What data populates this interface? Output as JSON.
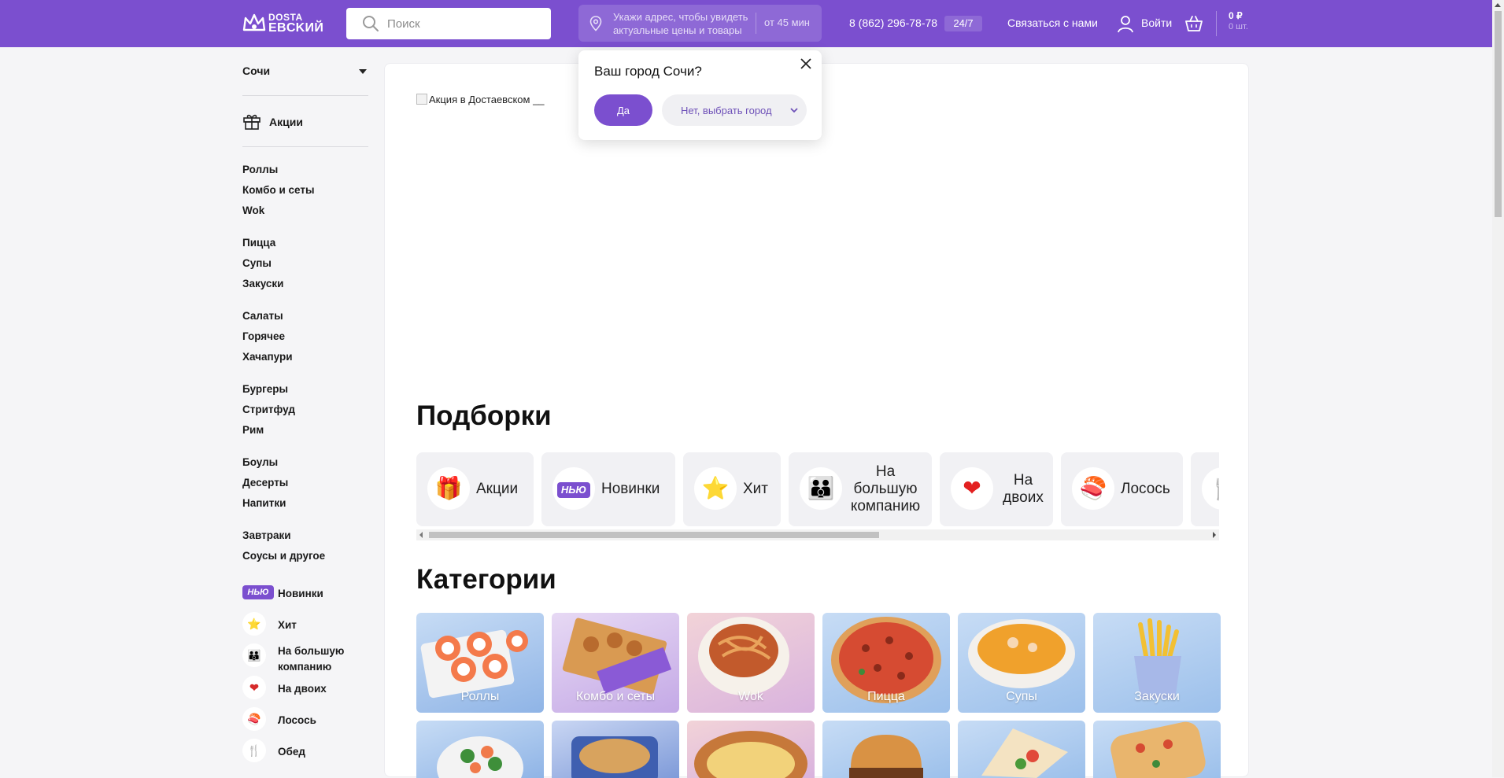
{
  "header": {
    "logo_line1": "DOSTA",
    "logo_line2": "EBCKИЙ",
    "search_placeholder": "Поиск",
    "address_prompt": "Укажи адрес, чтобы увидеть актуальные цены и товары",
    "delivery_time": "от 45 мин",
    "phone": "8 (862) 296-78-78",
    "hours_badge": "24/7",
    "contact_label": "Связаться с нами",
    "login_label": "Войти",
    "cart_sum": "0 ₽",
    "cart_count": "0 шт.",
    "accent_color": "#7b4fcf"
  },
  "sidebar": {
    "city": "Сочи",
    "promo_label": "Акции",
    "groups": [
      [
        "Роллы",
        "Комбо и сеты",
        "Wok"
      ],
      [
        "Пицца",
        "Супы",
        "Закуски"
      ],
      [
        "Салаты",
        "Горячее",
        "Хачапури"
      ],
      [
        "Бургеры",
        "Стритфуд",
        "Рим"
      ],
      [
        "Боулы",
        "Десерты",
        "Напитки"
      ],
      [
        "Завтраки",
        "Соусы и другое"
      ]
    ],
    "new_badge": "НЬЮ",
    "tags": [
      {
        "label": "Новинки",
        "icon": "new-badge"
      },
      {
        "label": "Хит",
        "icon": "star-icon"
      },
      {
        "label": "На большую компанию",
        "icon": "family-icon"
      },
      {
        "label": "На двоих",
        "icon": "heart-icon"
      },
      {
        "label": "Лосось",
        "icon": "salmon-icon"
      },
      {
        "label": "Обед",
        "icon": "cutlery-icon"
      }
    ]
  },
  "city_popup": {
    "title": "Ваш город Сочи?",
    "yes_label": "Да",
    "no_label": "Нет, выбрать город"
  },
  "main": {
    "banner_alt": "Акция в Достаевском",
    "collections_title": "Подборки",
    "collections": [
      {
        "label": "Акции",
        "icon": "gift-icon"
      },
      {
        "label": "Новинки",
        "icon": "new-badge"
      },
      {
        "label": "Хит",
        "icon": "star-icon"
      },
      {
        "label": "На большую компанию",
        "icon": "family-icon"
      },
      {
        "label": "На двоих",
        "icon": "heart-icon"
      },
      {
        "label": "Лосось",
        "icon": "salmon-icon"
      }
    ],
    "categories_title": "Категории",
    "categories": [
      "Роллы",
      "Комбо и сеты",
      "Wok",
      "Пицца",
      "Супы",
      "Закуски"
    ]
  }
}
